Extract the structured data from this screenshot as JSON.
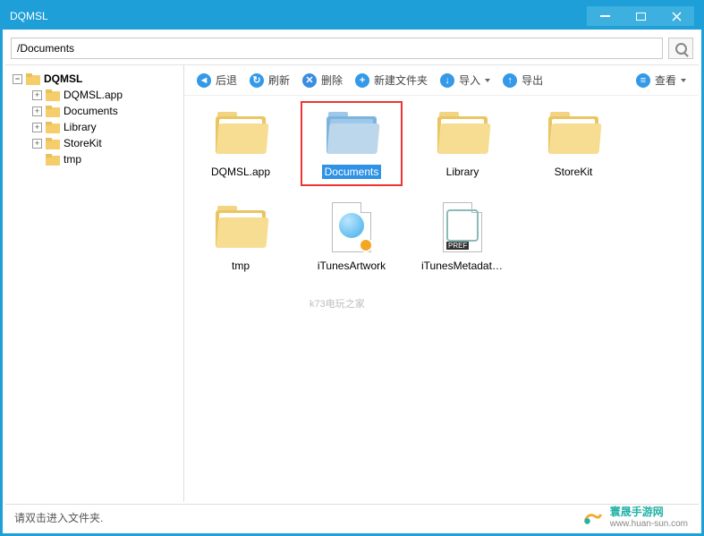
{
  "window": {
    "title": "DQMSL"
  },
  "addressBar": {
    "path": "/Documents"
  },
  "tree": {
    "root": "DQMSL",
    "children": [
      {
        "label": "DQMSL.app",
        "expandable": true
      },
      {
        "label": "Documents",
        "expandable": true
      },
      {
        "label": "Library",
        "expandable": true
      },
      {
        "label": "StoreKit",
        "expandable": true
      },
      {
        "label": "tmp",
        "expandable": false
      }
    ]
  },
  "toolbar": {
    "back": "后退",
    "refresh": "刷新",
    "delete": "删除",
    "newFolder": "新建文件夹",
    "import": "导入",
    "export": "导出",
    "view": "查看"
  },
  "items": [
    {
      "label": "DQMSL.app",
      "type": "folder",
      "selected": false
    },
    {
      "label": "Documents",
      "type": "folder",
      "selected": true
    },
    {
      "label": "Library",
      "type": "folder",
      "selected": false
    },
    {
      "label": "StoreKit",
      "type": "folder",
      "selected": false
    },
    {
      "label": "tmp",
      "type": "folder",
      "selected": false
    },
    {
      "label": "iTunesArtwork",
      "type": "file-qq",
      "selected": false
    },
    {
      "label": "iTunesMetadata.p...",
      "type": "file-pref",
      "selected": false
    }
  ],
  "status": {
    "text": "请双击进入文件夹."
  },
  "branding": {
    "name": "寰晟手游网",
    "url": "www.huan-sun.com"
  },
  "watermark": "k73电玩之家"
}
